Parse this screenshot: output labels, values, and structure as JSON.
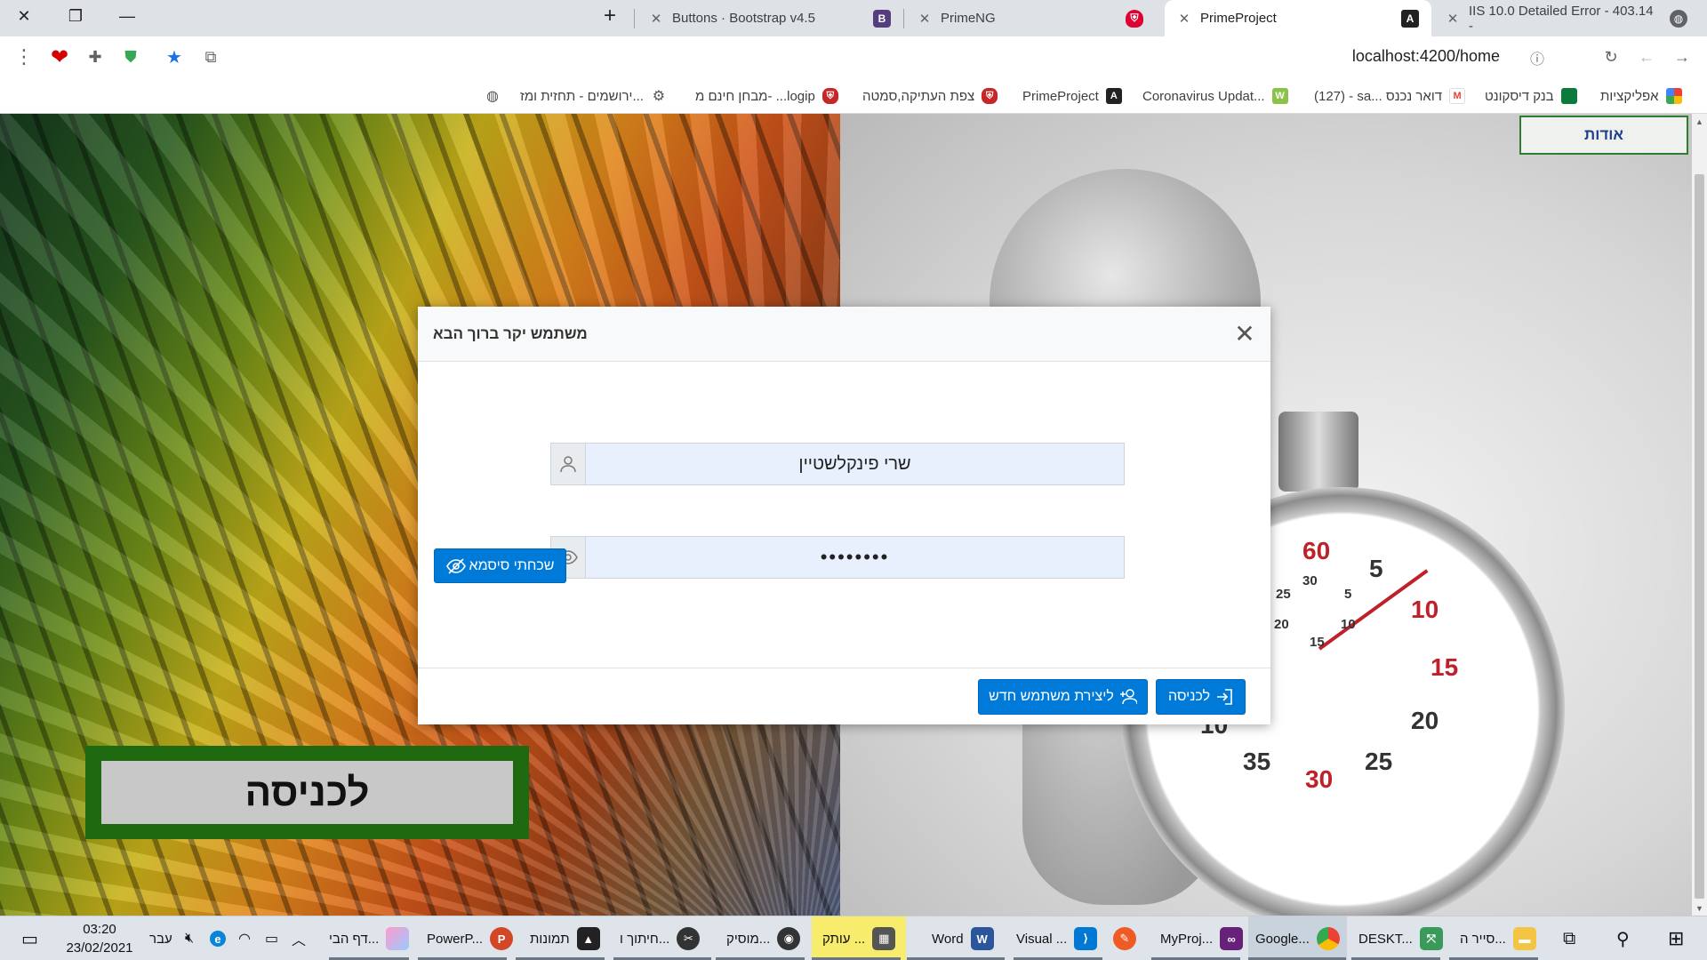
{
  "browser": {
    "tabs": [
      {
        "label": "Buttons · Bootstrap v4.5",
        "favicon": "B"
      },
      {
        "label": "PrimeNG",
        "favicon": "shield"
      },
      {
        "label": "PrimeProject",
        "favicon": "A"
      },
      {
        "label": "IIS 10.0 Detailed Error - 403.14 -",
        "favicon": "globe"
      }
    ],
    "new_tab_symbol": "+",
    "url": "localhost:4200/home",
    "bookmarks": [
      {
        "label": "אפליקציות"
      },
      {
        "label": "בנק דיסקונט"
      },
      {
        "label": "(127) - sa... דואר נכנס"
      },
      {
        "label": "Coronavirus Updat..."
      },
      {
        "label": "PrimeProject"
      },
      {
        "label": "צפת העתיקה,סמטה"
      },
      {
        "label": "מבחן חינם מ- ...logip"
      },
      {
        "label": "ירושמים - תחזית ומז..."
      }
    ]
  },
  "page": {
    "about_label": "אודות",
    "enter_label": "לכניסה",
    "stopwatch_numbers": [
      "60",
      "5",
      "10",
      "15",
      "20",
      "25",
      "30",
      "35",
      "10"
    ],
    "stopwatch_small_numbers": [
      "30",
      "25",
      "5",
      "20",
      "10",
      "15"
    ]
  },
  "dialog": {
    "title": "משתמש יקר ברוך הבא",
    "username_value": "שרי פינקלשטיין",
    "password_value": "••••••••",
    "forgot_label": "שכחתי סיסמא",
    "register_label": "ליצירת משתמש חדש",
    "login_label": "לכניסה"
  },
  "taskbar": {
    "time": "03:20",
    "date": "23/02/2021",
    "language": "עבר",
    "apps": [
      {
        "label": "סייר ה..."
      },
      {
        "label": "DESKT..."
      },
      {
        "label": "Google..."
      },
      {
        "label": "MyProj..."
      },
      {
        "label": "Visual ..."
      },
      {
        "label": "Word"
      },
      {
        "label": "עותק ..."
      },
      {
        "label": "מוסיק..."
      },
      {
        "label": "חיתוך ו..."
      },
      {
        "label": "תמונות"
      },
      {
        "label": "PowerP..."
      },
      {
        "label": "דף הבי..."
      }
    ]
  },
  "colors": {
    "primary_button": "#007ad9",
    "enter_frame": "#1f6a10",
    "about_border": "#2e7d32"
  }
}
